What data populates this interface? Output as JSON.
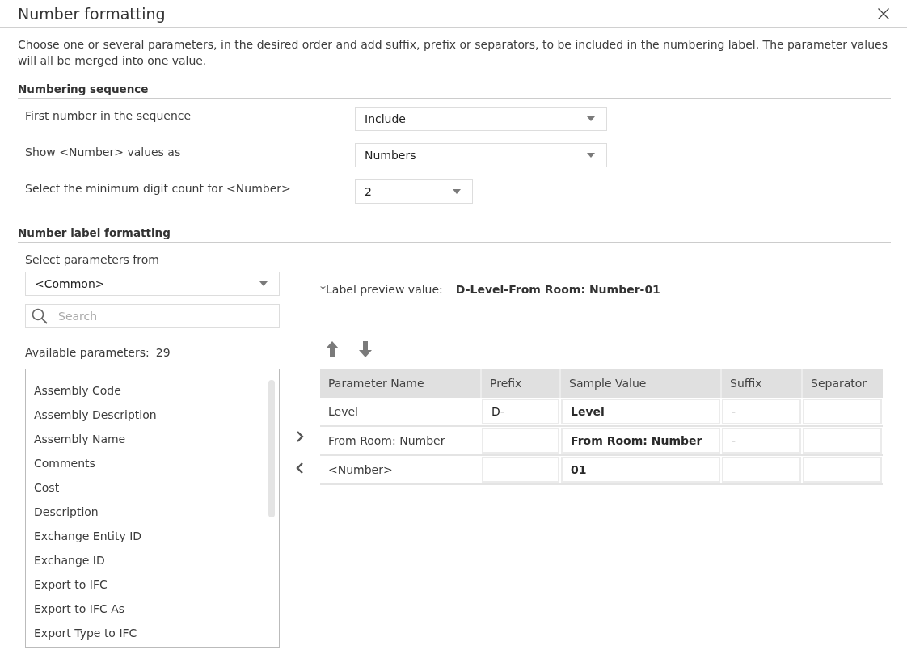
{
  "dialog": {
    "title": "Number formatting"
  },
  "intro": "Choose one or several parameters, in the desired order and add suffix, prefix or separators, to be included in the numbering label. The parameter values will all be merged into one value.",
  "numbering_sequence": {
    "heading": "Numbering sequence",
    "settings": [
      {
        "label": "First number in the sequence",
        "value": "Include"
      },
      {
        "label": "Show <Number> values as",
        "value": "Numbers"
      },
      {
        "label": "Select the minimum digit count for <Number>",
        "value": "2"
      }
    ]
  },
  "number_label_formatting": {
    "heading": "Number label formatting",
    "parameter_source": {
      "label": "Select parameters from",
      "value": "<Common>"
    },
    "search": {
      "placeholder": "Search"
    },
    "available_parameters": {
      "label": "Available parameters:",
      "count": "29",
      "items": [
        "Assembly Code",
        "Assembly Description",
        "Assembly Name",
        "Comments",
        "Cost",
        "Description",
        "Exchange Entity ID",
        "Exchange ID",
        "Export to IFC",
        "Export to IFC As",
        "Export Type to IFC"
      ]
    },
    "preview": {
      "label": "*Label preview value:",
      "value": "D-Level-From Room: Number-01"
    },
    "table": {
      "columns": [
        {
          "label": "Parameter Name",
          "kind": "name"
        },
        {
          "label": "Prefix",
          "kind": "field"
        },
        {
          "label": "Sample Value",
          "kind": "sample"
        },
        {
          "label": "Suffix",
          "kind": "field"
        },
        {
          "label": "Separator",
          "kind": "field"
        }
      ],
      "rows": [
        {
          "parameter_name": "Level",
          "prefix": "D-",
          "sample_value": "Level",
          "suffix": "-"
        },
        {
          "parameter_name": "From Room: Number",
          "sample_value": "From Room: Number",
          "suffix": "-"
        },
        {
          "parameter_name": "<Number>",
          "sample_value": "01"
        }
      ]
    }
  }
}
